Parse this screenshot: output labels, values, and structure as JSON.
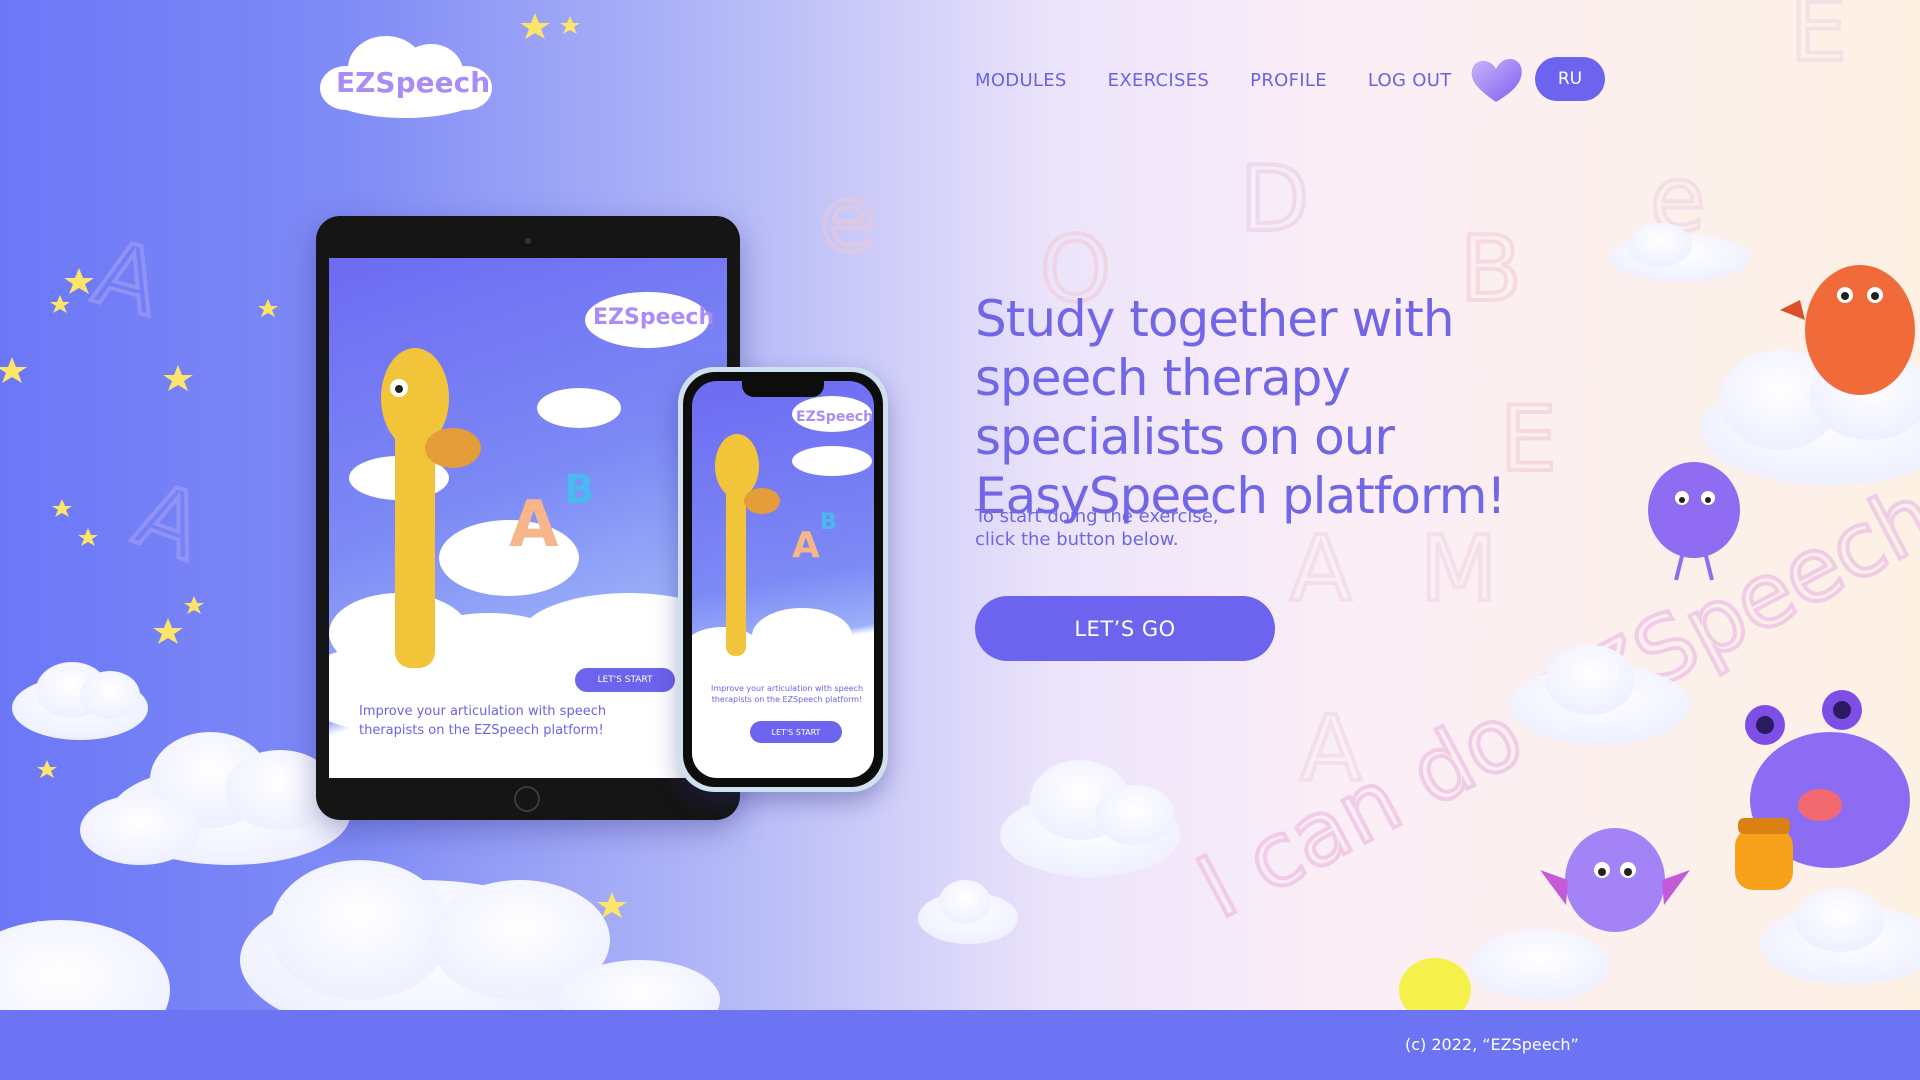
{
  "header": {
    "logo_text": "EZSpeech",
    "nav": [
      {
        "label": "MODULES"
      },
      {
        "label": "EXERCISES"
      },
      {
        "label": "PROFILE"
      },
      {
        "label": "LOG OUT"
      }
    ],
    "lang_label": "RU"
  },
  "hero": {
    "title": "Study together with speech therapy specialists on our EasySpeech platform!",
    "subtitle": "To start doing the exercise,\nclick the button below.",
    "cta_label": "LET’S GO"
  },
  "devices": {
    "tablet": {
      "logo_text": "EZSpeech",
      "caption": "Improve your articulation with speech\ntherapists on the EZSpeech platform!",
      "button_label": "LET'S START"
    },
    "phone": {
      "logo_text": "EZSpeech",
      "caption": "Improve your articulation with speech\ntherapists on the EZSpeech platform!",
      "button_label": "LET'S START"
    }
  },
  "background": {
    "slogan": "I can do EZSpeech"
  },
  "footer": {
    "copyright": "(c) 2022, “EZSpeech”"
  },
  "colors": {
    "accent": "#6c63ee",
    "nav_text": "#6b63e6",
    "footer": "#6c74f4"
  }
}
